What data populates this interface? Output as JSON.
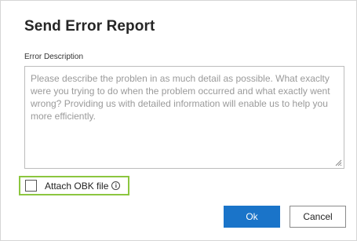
{
  "dialog": {
    "title": "Send Error Report",
    "description": {
      "label": "Error Description",
      "placeholder": "Please describe the problen in as much detail as possible. What exaclty were you trying to do when the problem occurred and what exactly went wrong? Providing us with detailed information will enable us to help you more efficiently.",
      "value": ""
    },
    "attach": {
      "label": "Attach OBK file",
      "checked": false,
      "info_icon": "info-icon"
    },
    "buttons": {
      "ok_label": "Ok",
      "cancel_label": "Cancel"
    }
  },
  "colors": {
    "primary_button": "#1a74c9",
    "highlight_border": "#8cc63f"
  }
}
